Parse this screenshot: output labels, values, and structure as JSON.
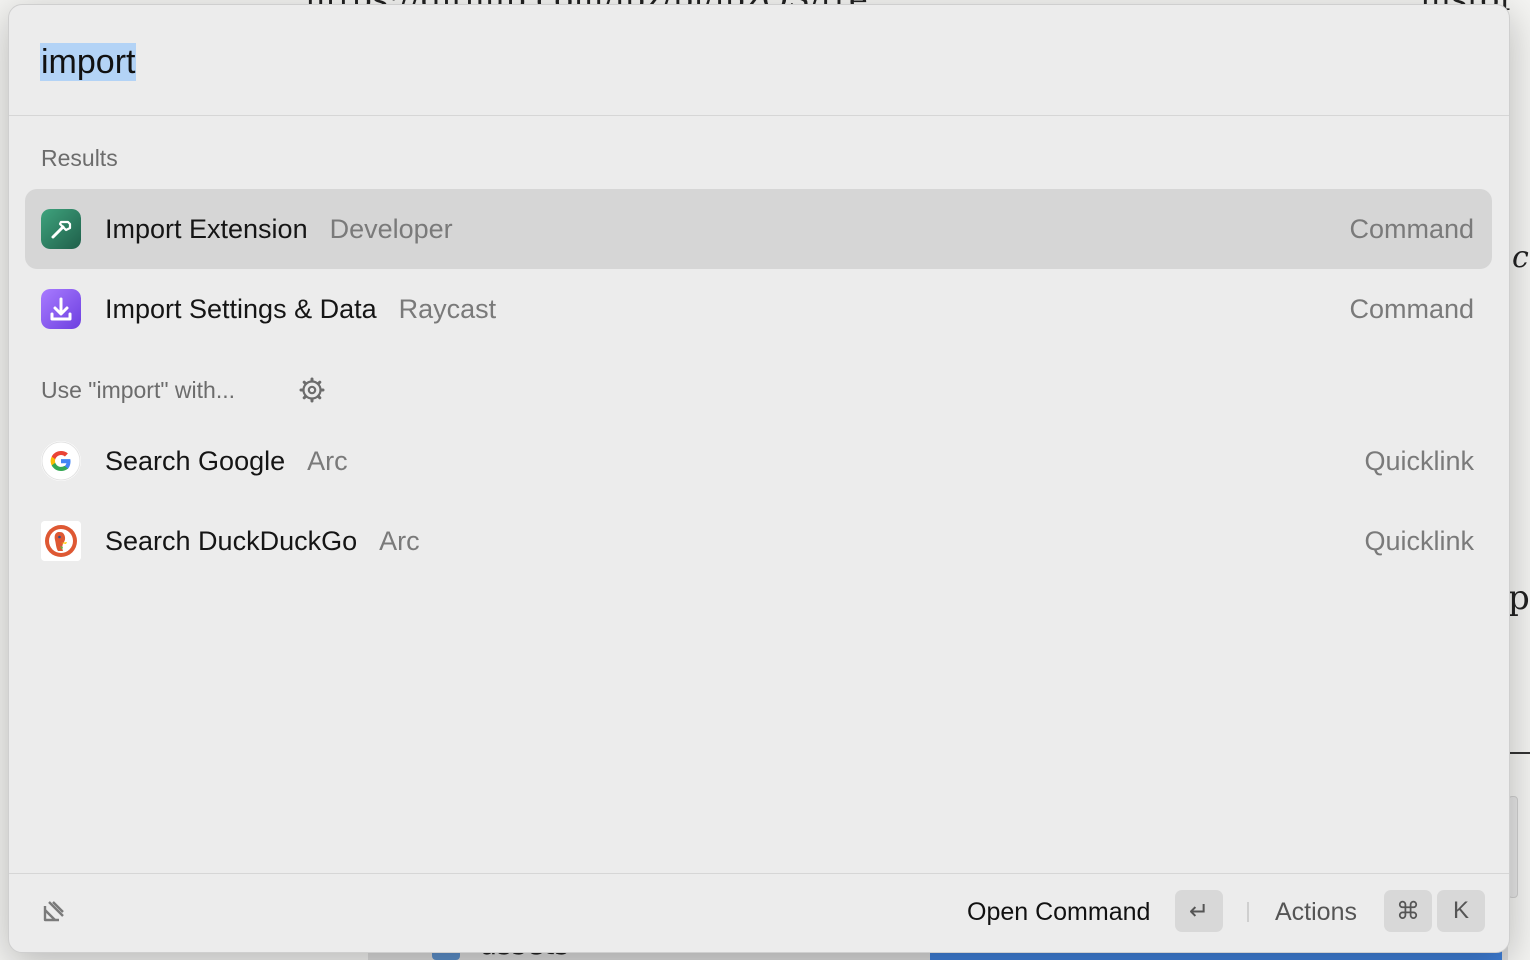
{
  "background": {
    "top_text": "https://github.com/ibz/pi/ibzOS/tre",
    "top_right_text": "histor",
    "right_glyph_a": "c",
    "right_glyph_p": "p",
    "bottom_text": "assets"
  },
  "search": {
    "query": "import"
  },
  "sections": {
    "results_label": "Results",
    "fallback_label": "Use \"import\" with..."
  },
  "results": [
    {
      "title": "Import Extension",
      "subtitle": "Developer",
      "type": "Command",
      "icon": "hammer-icon",
      "icon_color": "#2f8a6a",
      "selected": true
    },
    {
      "title": "Import Settings & Data",
      "subtitle": "Raycast",
      "type": "Command",
      "icon": "download-icon",
      "icon_color": "#8b5cf6",
      "selected": false
    }
  ],
  "fallbacks": [
    {
      "title": "Search Google",
      "subtitle": "Arc",
      "type": "Quicklink",
      "icon": "google-icon"
    },
    {
      "title": "Search DuckDuckGo",
      "subtitle": "Arc",
      "type": "Quicklink",
      "icon": "duckduckgo-icon"
    }
  ],
  "footer": {
    "primary_action": "Open Command",
    "enter_key": "↵",
    "actions_label": "Actions",
    "cmd_key": "⌘",
    "k_key": "K"
  }
}
